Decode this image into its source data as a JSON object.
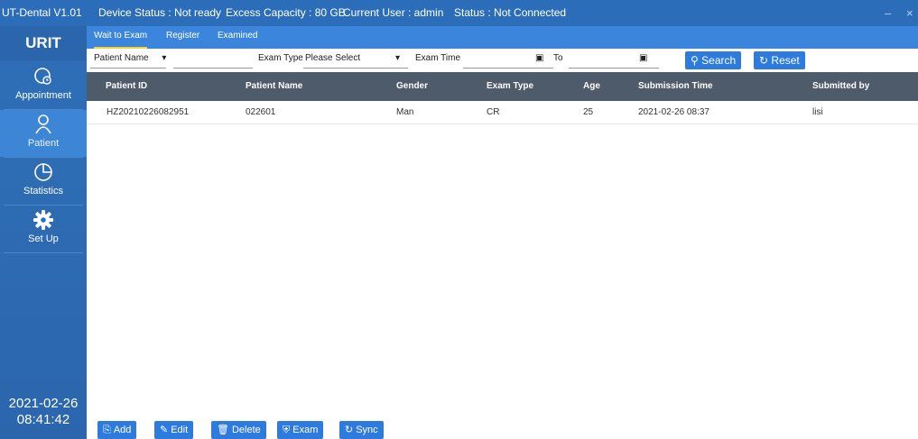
{
  "titlebar": {
    "app": "UT-Dental V1.01",
    "device_status": "Device Status : Not ready",
    "capacity": "Excess Capacity : 80 GB",
    "user": "Current User : admin",
    "conn_status": "Status : Not Connected",
    "minimize": "–",
    "close": "×"
  },
  "sidebar": {
    "logo": "URIT",
    "items": [
      {
        "label": "Appointment",
        "icon": "appointment-icon"
      },
      {
        "label": "Patient",
        "icon": "user-icon"
      },
      {
        "label": "Statistics",
        "icon": "pie-chart-icon"
      },
      {
        "label": "Set Up",
        "icon": "gear-icon"
      }
    ],
    "date": "2021-02-26",
    "time": "08:41:42"
  },
  "tabs": [
    "Wait to Exam",
    "Register",
    "Examined"
  ],
  "filters": {
    "patient_field": "Patient Name",
    "exam_type_label": "Exam Type",
    "exam_type_value": "Please Select",
    "exam_time_label": "Exam Time",
    "to_label": "To",
    "search": "Search",
    "reset": "Reset"
  },
  "table": {
    "headers": [
      "Patient ID",
      "Patient Name",
      "Gender",
      "Exam Type",
      "Age",
      "Submission Time",
      "Submitted by"
    ],
    "rows": [
      [
        "HZ20210226082951",
        "022601",
        "Man",
        "CR",
        "25",
        "2021-02-26 08:37",
        "lisi"
      ]
    ]
  },
  "actions": [
    "Add",
    "Edit",
    "Delete",
    "Exam",
    "Sync"
  ],
  "colors": {
    "accent": "#2e7be0",
    "titlebar": "#2b6db8",
    "header": "#4e5b6a",
    "tab_underline": "#f6d23a"
  }
}
